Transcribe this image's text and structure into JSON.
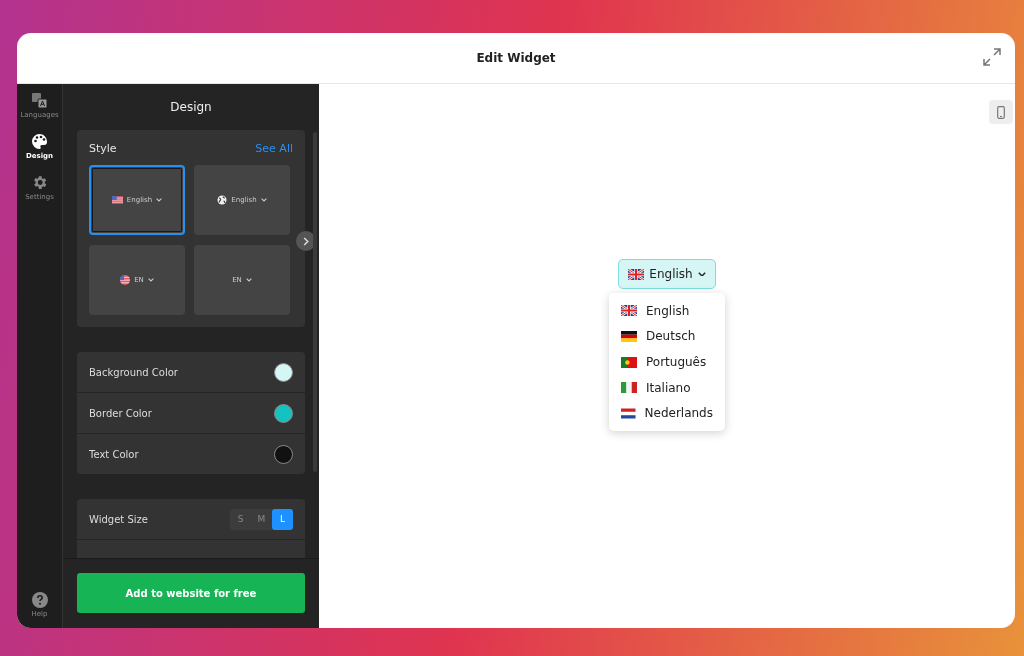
{
  "window": {
    "title": "Edit Widget"
  },
  "rail": [
    {
      "label": "Languages",
      "selected": false
    },
    {
      "label": "Design",
      "selected": true
    },
    {
      "label": "Settings",
      "selected": false
    }
  ],
  "help": {
    "label": "Help"
  },
  "panel": {
    "title": "Design",
    "style": {
      "title": "Style",
      "link": "See All",
      "options": [
        {
          "kind": "flag-label",
          "label": "English",
          "selected": true
        },
        {
          "kind": "globe-label",
          "label": "English",
          "selected": false
        },
        {
          "kind": "round-flag-code",
          "label": "EN",
          "selected": false
        },
        {
          "kind": "code",
          "label": "EN",
          "selected": false
        }
      ]
    },
    "colors": [
      {
        "label": "Background Color",
        "color": "#d6f5f5"
      },
      {
        "label": "Border Color",
        "color": "#14c2c2"
      },
      {
        "label": "Text Color",
        "color": "#111111"
      }
    ],
    "widget_size": {
      "label": "Widget Size",
      "options": [
        {
          "label": "S",
          "selected": false
        },
        {
          "label": "M",
          "selected": false
        },
        {
          "label": "L",
          "selected": true
        }
      ]
    },
    "cta": "Add to website for free"
  },
  "preview": {
    "widget": {
      "label": "English"
    },
    "menu": [
      {
        "label": "English"
      },
      {
        "label": "Deutsch"
      },
      {
        "label": "Português"
      },
      {
        "label": "Italiano"
      },
      {
        "label": "Nederlands"
      }
    ]
  }
}
